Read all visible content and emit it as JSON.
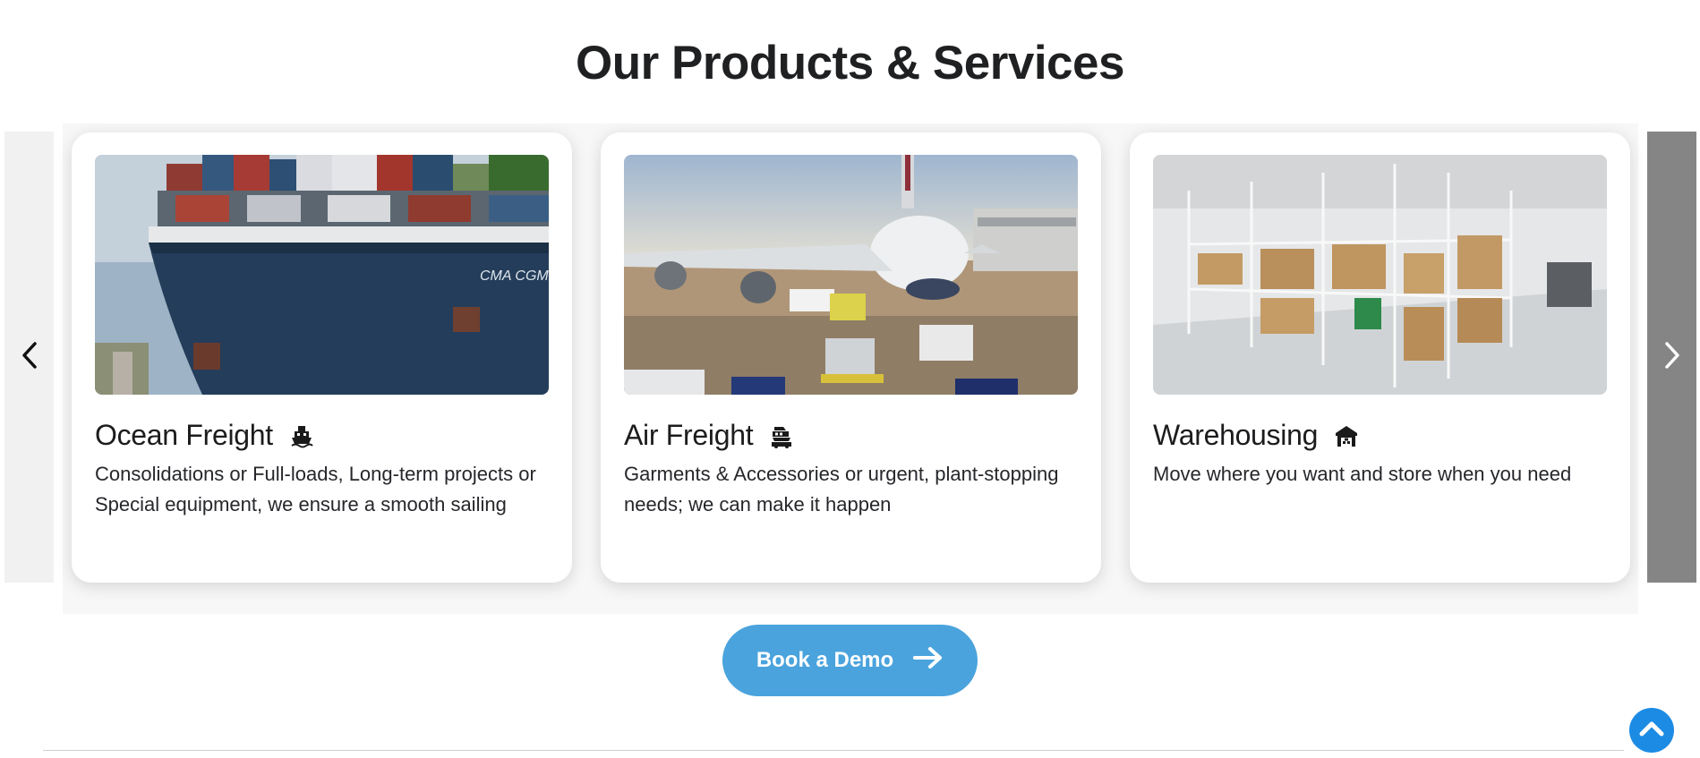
{
  "section": {
    "title": "Our Products & Services"
  },
  "carousel": {
    "prev_icon": "chevron-left-icon",
    "next_icon": "chevron-right-icon",
    "cards": [
      {
        "title": "Ocean Freight",
        "icon": "ship-icon",
        "description": "Consolidations or Full-loads, Long-term projects or Special equipment, we ensure a smooth sailing",
        "image": "container-ship-bow"
      },
      {
        "title": "Air Freight",
        "icon": "cargo-transport-icon",
        "description": "Garments & Accessories or urgent, plant-stopping needs; we can make it happen",
        "image": "cargo-airplane-loading"
      },
      {
        "title": "Warehousing",
        "icon": "warehouse-icon",
        "description": "Move where you want and store when you need",
        "image": "warehouse-racks"
      }
    ]
  },
  "cta": {
    "label": "Book a Demo",
    "icon": "arrow-right-icon"
  },
  "scroll_top": {
    "icon": "chevron-up-icon"
  },
  "colors": {
    "accent": "#4aa3dd",
    "scroll_top": "#1c8be4",
    "next_nav": "#858585",
    "prev_nav": "#f1f1f1"
  }
}
